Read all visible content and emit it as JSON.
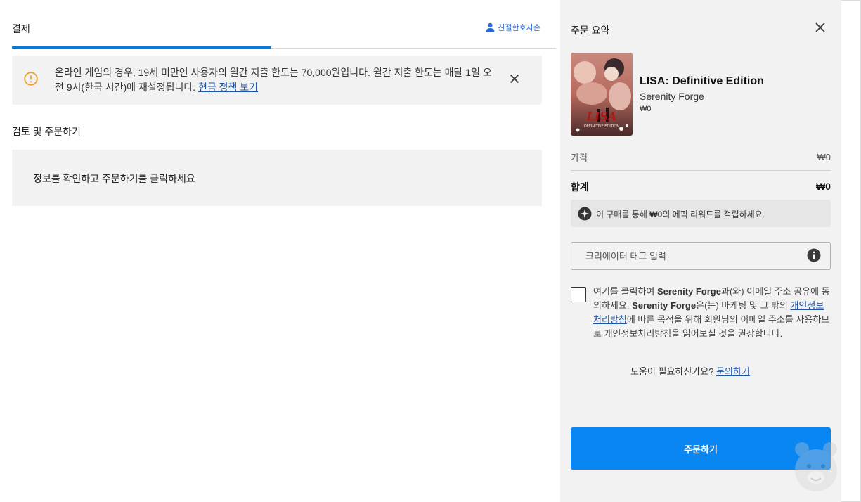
{
  "checkout": {
    "tab_label": "결제",
    "user_link": "친절한호자손",
    "alert": {
      "text": "온라인 게임의 경우, 19세 미만인 사용자의 월간 지출 한도는 70,000원입니다. 월간 지출 한도는 매달 1일 오전 9시(한국 시간)에 재설정됩니다. ",
      "link": "현금 정책 보기"
    },
    "section_title": "검토 및 주문하기",
    "review_text": "정보를 확인하고 주문하기를 클릭하세요"
  },
  "summary": {
    "title": "주문 요약",
    "product": {
      "name": "LISA: Definitive Edition",
      "developer": "Serenity Forge",
      "price": "₩0"
    },
    "price_label": "가격",
    "price_value": "₩0",
    "total_label": "합계",
    "total_value": "₩0",
    "reward": {
      "pre": "이 구매를 통해 ",
      "amount": "₩0",
      "post": "의 에픽 리워드를 적립하세요."
    },
    "creator_placeholder": "크리에이터 태그 입력",
    "consent": {
      "part1": "여기를 클릭하여 ",
      "name1": "Serenity Forge",
      "part2": "과(와) 이메일 주소 공유에 동의하세요. ",
      "name2": "Serenity Forge",
      "part3": "은(는) 마케팅 및 그 밖의 ",
      "link": "개인정보처리방침",
      "part4": "에 따른 목적을 위해 회원님의 이메일 주소를 사용하므로 개인정보처리방침을 읽어보실 것을 권장합니다."
    },
    "help_text": "도움이 필요하신가요? ",
    "help_link": "문의하기",
    "order_button": "주문하기"
  },
  "colors": {
    "accent": "#0a86f2",
    "tab_underline": "#0a7ad6",
    "alert_icon": "#f0a030",
    "link": "#1f55a8"
  },
  "icons": [
    "user-icon",
    "warning-circle-icon",
    "close-icon",
    "epic-reward-icon",
    "info-icon",
    "mascot-watermark"
  ]
}
